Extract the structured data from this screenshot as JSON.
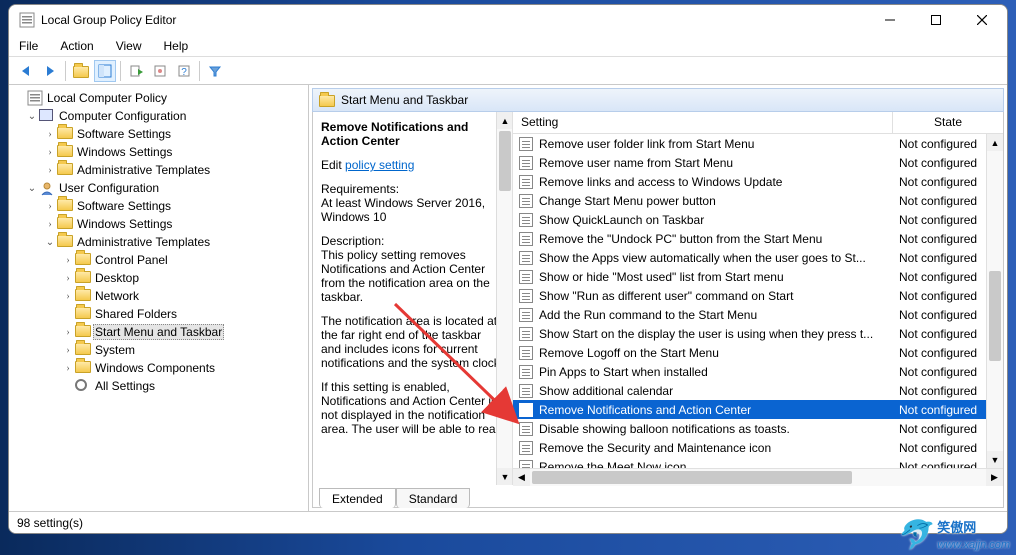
{
  "window": {
    "title": "Local Group Policy Editor"
  },
  "menu": {
    "file": "File",
    "action": "Action",
    "view": "View",
    "help": "Help"
  },
  "tree": {
    "root": "Local Computer Policy",
    "comp": "Computer Configuration",
    "comp_children": {
      "sw": "Software Settings",
      "win": "Windows Settings",
      "adm": "Administrative Templates"
    },
    "user": "User Configuration",
    "user_children": {
      "sw": "Software Settings",
      "win": "Windows Settings",
      "adm": "Administrative Templates"
    },
    "adm_children": {
      "cp": "Control Panel",
      "desktop": "Desktop",
      "network": "Network",
      "shared": "Shared Folders",
      "start": "Start Menu and Taskbar",
      "system": "System",
      "wincomp": "Windows Components",
      "all": "All Settings"
    }
  },
  "pane": {
    "header": "Start Menu and Taskbar",
    "policy_title": "Remove Notifications and Action Center",
    "edit_prefix": "Edit ",
    "edit_link": "policy setting",
    "req_head": "Requirements:",
    "req_body": "At least Windows Server 2016, Windows 10",
    "desc_head": "Description:",
    "desc_p1": "This policy setting removes Notifications and Action Center from the notification area on the taskbar.",
    "desc_p2": "The notification area is located at the far right end of the taskbar and includes icons for current notifications and the system clock.",
    "desc_p3": "If this setting is enabled, Notifications and Action Center is not displayed in the notification area. The user will be able to read"
  },
  "columns": {
    "setting": "Setting",
    "state": "State"
  },
  "nc": "Not configured",
  "rows": [
    {
      "label": "Remove user folder link from Start Menu"
    },
    {
      "label": "Remove user name from Start Menu"
    },
    {
      "label": "Remove links and access to Windows Update"
    },
    {
      "label": "Change Start Menu power button"
    },
    {
      "label": "Show QuickLaunch on Taskbar"
    },
    {
      "label": "Remove the \"Undock PC\" button from the Start Menu"
    },
    {
      "label": "Show the Apps view automatically when the user goes to St..."
    },
    {
      "label": "Show or hide \"Most used\" list from Start menu"
    },
    {
      "label": "Show \"Run as different user\" command on Start"
    },
    {
      "label": "Add the Run command to the Start Menu"
    },
    {
      "label": "Show Start on the display the user is using when they press t..."
    },
    {
      "label": "Remove Logoff on the Start Menu"
    },
    {
      "label": "Pin Apps to Start when installed"
    },
    {
      "label": "Show additional calendar"
    },
    {
      "label": "Remove Notifications and Action Center",
      "selected": true
    },
    {
      "label": "Disable showing balloon notifications as toasts."
    },
    {
      "label": "Remove the Security and Maintenance icon"
    },
    {
      "label": "Remove the Meet Now icon"
    }
  ],
  "tabs": {
    "extended": "Extended",
    "standard": "Standard"
  },
  "status": "98 setting(s)",
  "watermark": {
    "zh": "笑傲网",
    "url": "www.xajjn.com"
  }
}
